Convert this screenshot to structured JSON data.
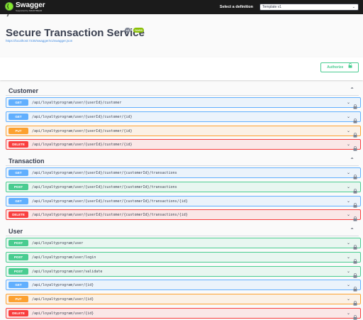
{
  "topbar": {
    "logo_text": "Swagger",
    "logo_sub": "Supported by SMARTBEAR",
    "definition_label": "Select a definition",
    "definition_value": "Template v1"
  },
  "info": {
    "title": "Secure Transaction Service",
    "version_badge": "v1",
    "oas_badge": "OAS3",
    "url": "https://localhost:7230/swagger/v1/swagger.json"
  },
  "authorize_label": "Authorize",
  "colors": {
    "get": "#61affe",
    "post": "#49cc90",
    "put": "#fca130",
    "delete": "#f93e3e",
    "topbar": "#1b1b1b"
  },
  "tags": [
    {
      "name": "Customer",
      "operations": [
        {
          "method": "GET",
          "path": "/api/loyaltyprogram/user/{userId}/customer"
        },
        {
          "method": "GET",
          "path": "/api/loyaltyprogram/user/{userId}/customer/{id}"
        },
        {
          "method": "PUT",
          "path": "/api/loyaltyprogram/user/{userId}/customer/{id}"
        },
        {
          "method": "DELETE",
          "path": "/api/loyaltyprogram/user/{userId}/customer/{id}"
        }
      ]
    },
    {
      "name": "Transaction",
      "operations": [
        {
          "method": "GET",
          "path": "/api/loyaltyprogram/user/{userId}/customer/{customerId}/transactions"
        },
        {
          "method": "POST",
          "path": "/api/loyaltyprogram/user/{userId}/customer/{customerId}/transactions"
        },
        {
          "method": "GET",
          "path": "/api/loyaltyprogram/user/{userId}/customer/{customerId}/transactions/{id}"
        },
        {
          "method": "DELETE",
          "path": "/api/loyaltyprogram/user/{userId}/customer/{customerId}/transactions/{id}"
        }
      ]
    },
    {
      "name": "User",
      "operations": [
        {
          "method": "POST",
          "path": "/api/loyaltyprogram/user"
        },
        {
          "method": "POST",
          "path": "/api/loyaltyprogram/user/login"
        },
        {
          "method": "POST",
          "path": "/api/loyaltyprogram/user/validate"
        },
        {
          "method": "GET",
          "path": "/api/loyaltyprogram/user/{id}"
        },
        {
          "method": "PUT",
          "path": "/api/loyaltyprogram/user/{id}"
        },
        {
          "method": "DELETE",
          "path": "/api/loyaltyprogram/user/{id}"
        }
      ]
    }
  ]
}
